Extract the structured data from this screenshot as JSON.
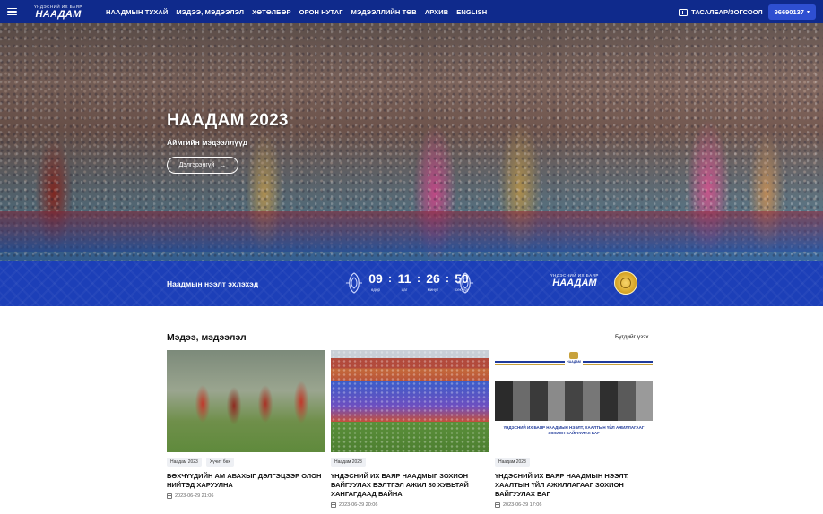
{
  "nav": {
    "logo_top": "ҮНДЭСНИЙ ИХ БАЯР",
    "logo_main": "НААДАМ",
    "items": [
      {
        "label": "НААДМЫН ТУХАЙ"
      },
      {
        "label": "МЭДЭЭ, МЭДЭЭЛЭЛ"
      },
      {
        "label": "ХӨТӨЛБӨР"
      },
      {
        "label": "ОРОН НУТАГ"
      },
      {
        "label": "МЭДЭЭЛЛИЙН ТӨВ"
      },
      {
        "label": "АРХИВ"
      },
      {
        "label": "ENGLISH"
      }
    ],
    "ticket_label": "ТАСАЛБАР/ЗОГСООЛ",
    "phone": "96690137"
  },
  "hero": {
    "title": "НААДАМ 2023",
    "subtitle": "Аймгийн мэдээллүүд",
    "button_label": "Дэлгэрэнгүй"
  },
  "countdown": {
    "label": "Наадмын нээлт эхлэхэд",
    "units": [
      {
        "value": "09",
        "label": "өдөр"
      },
      {
        "value": "11",
        "label": "цаг"
      },
      {
        "value": "26",
        "label": "минут"
      },
      {
        "value": "50",
        "label": "секунд"
      }
    ],
    "logo_top": "ҮНДЭСНИЙ ИХ БАЯР",
    "logo_main": "НААДАМ"
  },
  "news": {
    "title": "Мэдээ, мэдээлэл",
    "see_all": "Бүгдийг үзэх",
    "cards": [
      {
        "tags": [
          "Наадам 2023",
          "Хүчит бөх"
        ],
        "title": "БӨХЧҮҮДИЙН АМ АВАХЫГ ДЭЛГЭЦЭЭР ОЛОН НИЙТЭД ХАРУУЛНА",
        "date": "2023-06-29 21:06"
      },
      {
        "tags": [
          "Наадам 2023"
        ],
        "title": "ҮНДЭСНИЙ ИХ БАЯР НААДМЫГ ЗОХИОН БАЙГУУЛАХ БЭЛТГЭЛ АЖИЛ 80 ХУВЬТАЙ ХАНГАГДААД БАЙНА",
        "date": "2023-06-29 20:06"
      },
      {
        "tags": [
          "Наадам 2023"
        ],
        "title": "ҮНДЭСНИЙ ИХ БАЯР НААДМЫН НЭЭЛТ, ХААЛТЫН ҮЙЛ АЖИЛЛАГААГ ЗОХИОН БАЙГУУЛАХ БАГ",
        "date": "2023-06-29 17:06",
        "image_caption": "ҮНДЭСНИЙ ИХ БАЯР НААДМЫН НЭЭЛТ, ХААЛТЫН ҮЙЛ АЖИЛЛАГААГ ЗОХИОН БАЙГУУЛАХ БАГ",
        "image_emblem": "НААДАМ"
      }
    ]
  },
  "colors": {
    "nav_bg": "#0f2a8c",
    "countdown_bg": "#1c3fb8",
    "phone_pill": "#2e4fd1"
  },
  "icons": [
    "menu-icon",
    "ticket-icon",
    "chevron-down-icon",
    "arrow-right-icon",
    "calendar-icon",
    "ornament-icon",
    "medal-icon"
  ]
}
